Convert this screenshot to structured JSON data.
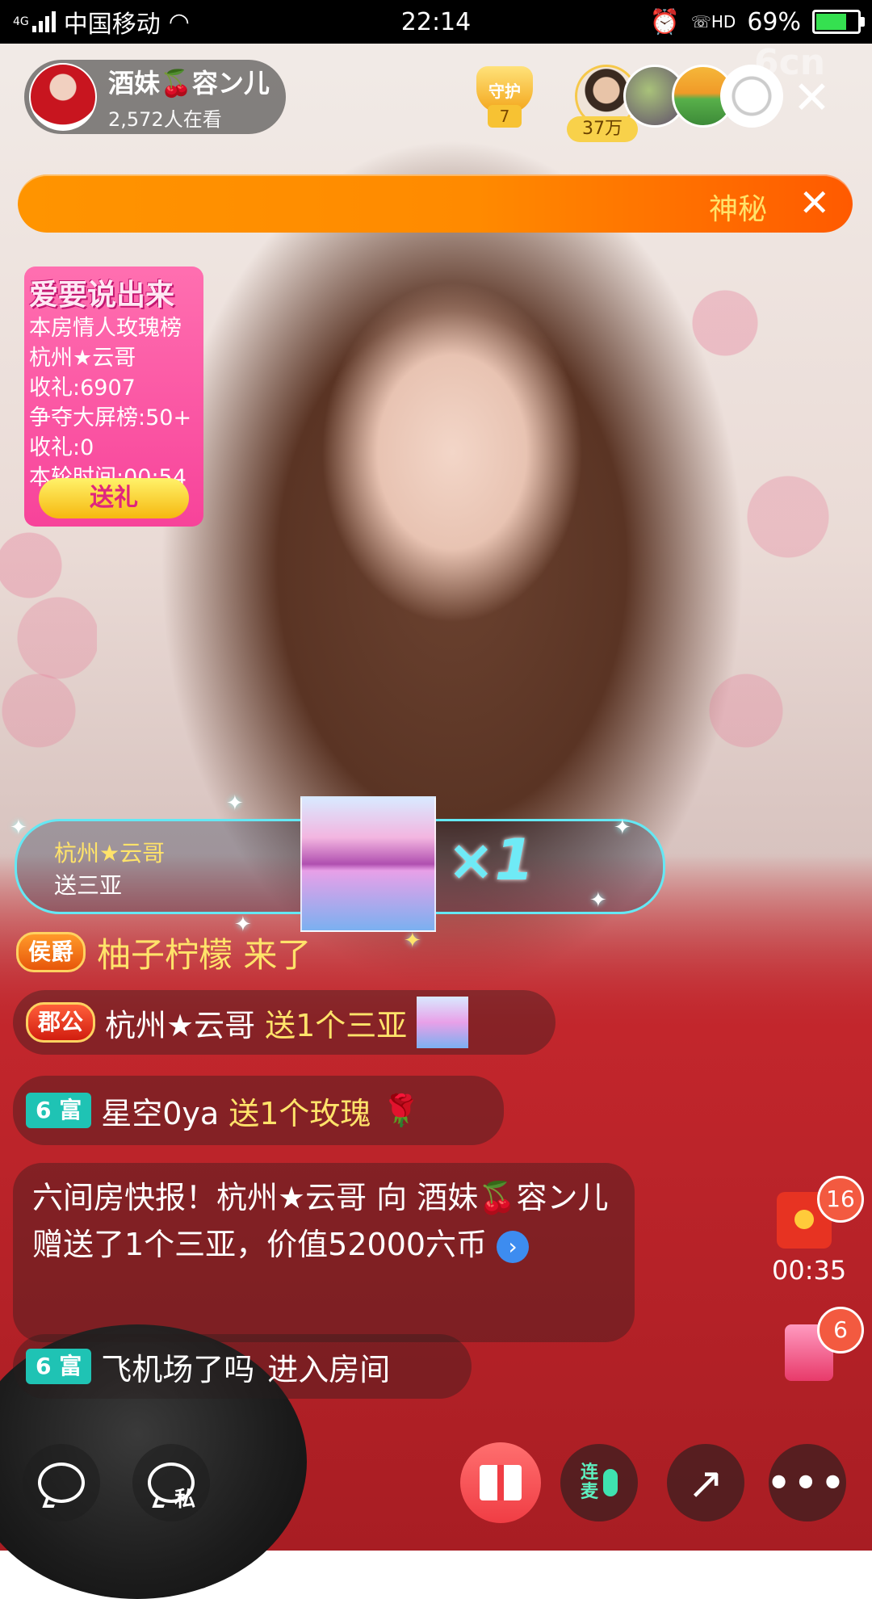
{
  "status_bar": {
    "network": "4G",
    "carrier": "中国移动",
    "time": "22:14",
    "volte": "HD",
    "battery": "69%"
  },
  "host": {
    "name": "酒妹🍒容ン儿",
    "viewers": "2,572人在看"
  },
  "guard": {
    "label": "守护",
    "count": "7"
  },
  "audience": {
    "badge": "37万"
  },
  "watermark": "6cn",
  "banner": {
    "text": "神秘"
  },
  "love_board": {
    "title": "爱要说出来",
    "lines": [
      "本房情人玫瑰榜",
      "杭州★云哥",
      "收礼:6907",
      "争夺大屏榜:50+",
      "收礼:0",
      "本轮时间:00:54"
    ],
    "button": "送礼"
  },
  "gift_popup": {
    "user": "杭州★云哥",
    "action": "送三亚",
    "multiplier": "×1"
  },
  "entrance": {
    "badge": "侯爵",
    "text": "柚子柠檬 来了"
  },
  "chat": [
    {
      "badge": "郡公",
      "name": "杭州★云哥",
      "action": "送1个三亚"
    },
    {
      "badge": "6 富",
      "name": "星空0ya",
      "action": "送1个玫瑰"
    },
    {
      "text": "六间房快报！杭州★云哥 向 酒妹🍒容ン儿赠送了1个三亚，价值52000六币"
    },
    {
      "badge": "6 富",
      "name": "飞机场了吗",
      "action": "进入房间"
    }
  ],
  "side": {
    "red_packet_count": "16",
    "red_packet_timer": "00:35",
    "box_count": "6"
  },
  "bottom": {
    "private_label": "私",
    "lianmai_line1": "连",
    "lianmai_line2": "麦"
  }
}
